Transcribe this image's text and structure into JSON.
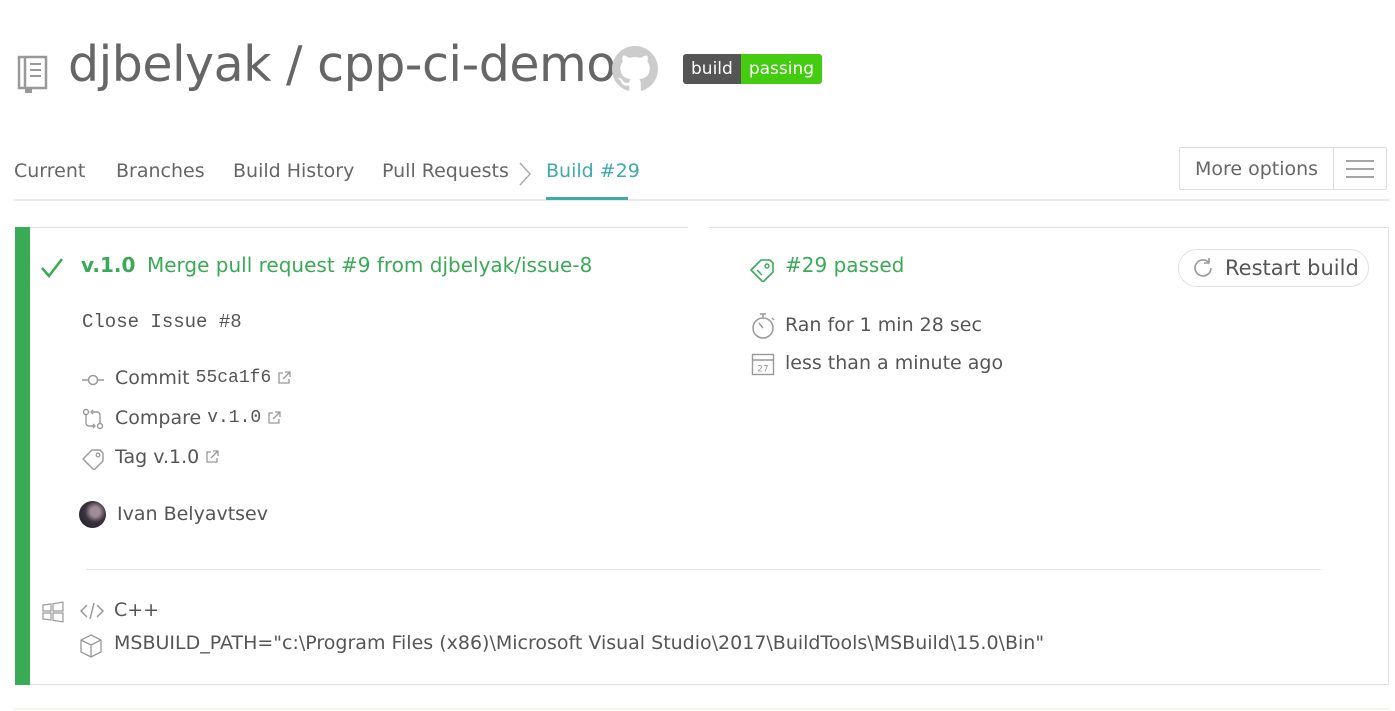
{
  "header": {
    "owner": "djbelyak",
    "separator": " / ",
    "repo": "cpp-ci-demo",
    "badge_left": "build",
    "badge_right": "passing",
    "icons": {
      "repo": "repo-book-icon",
      "github": "github-octocat-icon"
    }
  },
  "tabs": [
    {
      "label": "Current"
    },
    {
      "label": "Branches"
    },
    {
      "label": "Build History"
    },
    {
      "label": "Pull Requests"
    },
    {
      "label": "Build #29",
      "active": true
    }
  ],
  "more_options": {
    "label": "More options",
    "icon": "hamburger-menu-icon"
  },
  "build": {
    "tag": "v.1.0",
    "commit_subject": "Merge pull request #9 from djbelyak/issue-8",
    "commit_body": "Close Issue #8",
    "commit": {
      "label": "Commit",
      "sha": "55ca1f6"
    },
    "compare": {
      "label": "Compare",
      "ref": "v.1.0"
    },
    "tag_link": {
      "label": "Tag v.1.0"
    },
    "author": "Ivan Belyavtsev",
    "status": "#29 passed",
    "duration": "Ran for 1 min 28 sec",
    "finished": "less than a minute ago",
    "calendar_day": "27",
    "restart_label": "Restart build",
    "language": "C++",
    "env": "MSBUILD_PATH=\"c:\\Program Files (x86)\\Microsoft Visual Studio\\2017\\BuildTools\\MSBuild\\15.0\\Bin\""
  },
  "colors": {
    "passed_green": "#39aa56",
    "tab_active": "#3eaaaf",
    "badge_grey": "#555555",
    "badge_green": "#44cc11",
    "text": "#666666"
  }
}
